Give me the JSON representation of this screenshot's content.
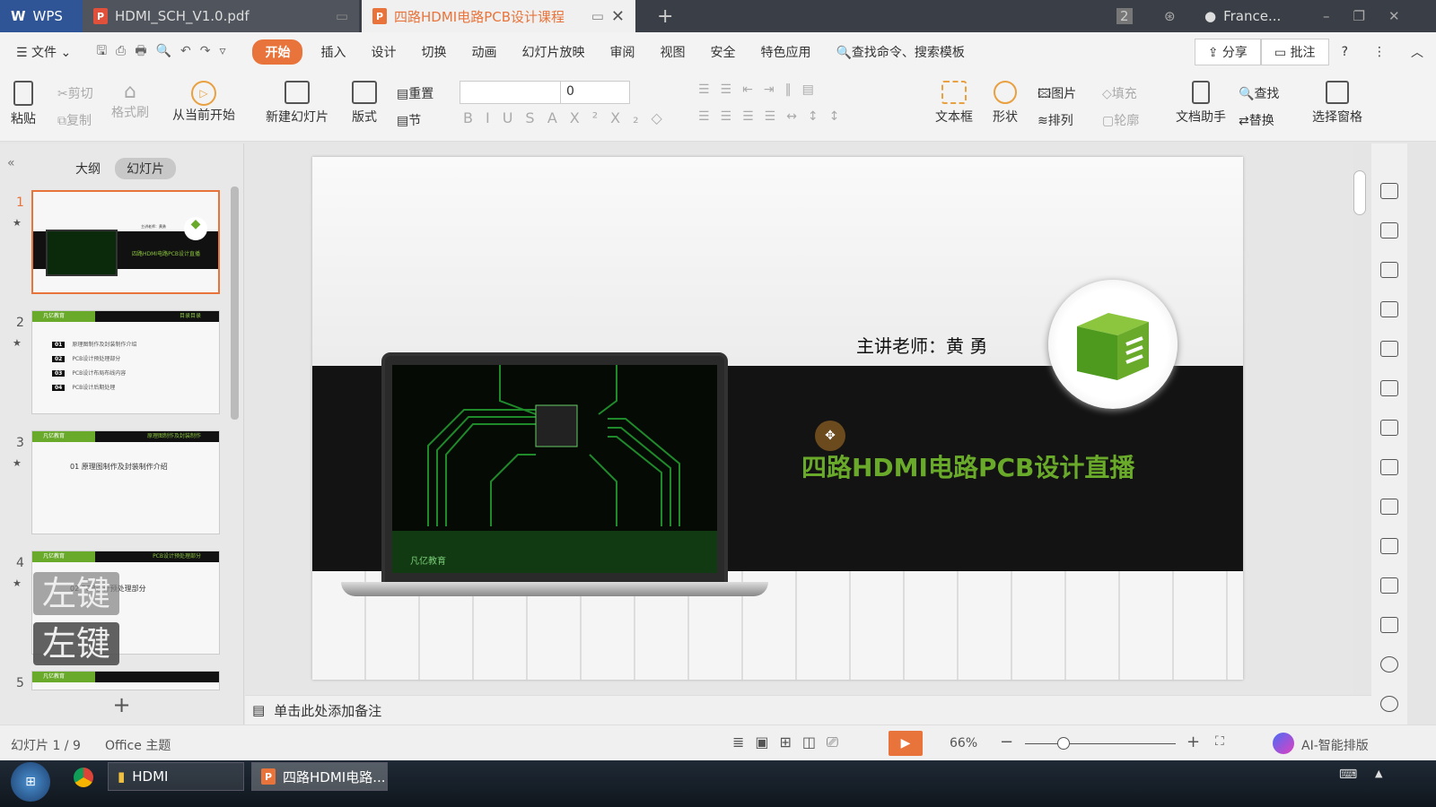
{
  "tabs": {
    "app": "WPS",
    "pdf": "HDMI_SCH_V1.0.pdf",
    "active": "四路HDMI电路PCB设计课程",
    "new_tab": "+",
    "page_count": "2",
    "user": "France..."
  },
  "menu": {
    "file": "文件",
    "items": [
      "开始",
      "插入",
      "设计",
      "切换",
      "动画",
      "幻灯片放映",
      "审阅",
      "视图",
      "安全",
      "特色应用"
    ],
    "search": "查找命令、搜索模板",
    "share": "分享",
    "comment": "批注"
  },
  "ribbon": {
    "paste": "粘贴",
    "cut": "剪切",
    "copy": "复制",
    "format_painter": "格式刷",
    "from_current": "从当前开始",
    "new_slide": "新建幻灯片",
    "layout": "版式",
    "reset": "重置",
    "section": "节",
    "font_size": "0",
    "textbox": "文本框",
    "shape": "形状",
    "picture": "图片",
    "fill": "填充",
    "arrange": "排列",
    "outline": "轮廓",
    "doc_assistant": "文档助手",
    "find": "查找",
    "replace": "替换",
    "select_pane": "选择窗格"
  },
  "panel": {
    "outline_tab": "大纲",
    "slides_tab": "幻灯片",
    "add": "+",
    "thumbs": [
      {
        "num": "1",
        "teacher": "主讲老师：黄勇",
        "title": "四路HDMI电路PCB设计直播"
      },
      {
        "num": "2",
        "header": "目录目录",
        "items": [
          [
            "01",
            "原理图制作及封装制作介绍"
          ],
          [
            "02",
            "PCB设计预处理部分"
          ],
          [
            "03",
            "PCB设计布局布线内容"
          ],
          [
            "04",
            "PCB设计后期处理"
          ]
        ]
      },
      {
        "num": "3",
        "header": "原理图制作及封装制作",
        "heading": "01  原理图制作及封装制作介绍"
      },
      {
        "num": "4",
        "header": "PCB设计预处理部分",
        "heading": "02  PCB设计预处理部分"
      },
      {
        "num": "5"
      }
    ],
    "overlay_key": "左键"
  },
  "slide": {
    "teacher": "主讲老师：黄 勇",
    "title": "四路HDMI电路PCB设计直播",
    "brand": "凡亿教育"
  },
  "notes": {
    "placeholder": "单击此处添加备注"
  },
  "status": {
    "slide_pos": "幻灯片 1 / 9",
    "theme": "Office 主题",
    "zoom": "66%",
    "zoom_percent": 66,
    "ai": "AI-智能排版"
  },
  "taskbar": {
    "item1": "HDMI",
    "item2": "四路HDMI电路..."
  },
  "colors": {
    "accent": "#e8743b",
    "green": "#6aaa2a",
    "wps_blue": "#2f5597"
  }
}
